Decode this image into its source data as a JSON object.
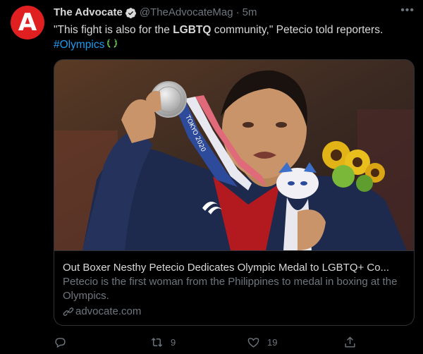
{
  "author": {
    "avatar_letter": "A",
    "name": "The Advocate",
    "handle": "@TheAdvocateMag",
    "separator": "·",
    "time": "5m",
    "avatar_color": "#e02020"
  },
  "tweet": {
    "text_before": "\"This fight is also for the ",
    "text_bold": "LGBTQ",
    "text_after": " community,\" Petecio told reporters.",
    "hashtag": "#Olympics"
  },
  "card": {
    "title": "Out Boxer Nesthy Petecio Dedicates Olympic Medal to LGBTQ+ Co...",
    "description": "Petecio is the first woman from the Philippines to medal in boxing at the Olympics.",
    "domain": "advocate.com",
    "image_icon": "medal-photo",
    "lanyard_text": "TOKYO 2020"
  },
  "actions": {
    "reply_count": "",
    "retweet_count": "9",
    "like_count": "19",
    "share_count": ""
  },
  "colors": {
    "background": "#000000",
    "text": "#d9d9d9",
    "muted": "#6e767d",
    "link": "#1d9bf0",
    "border": "#2f3336"
  }
}
